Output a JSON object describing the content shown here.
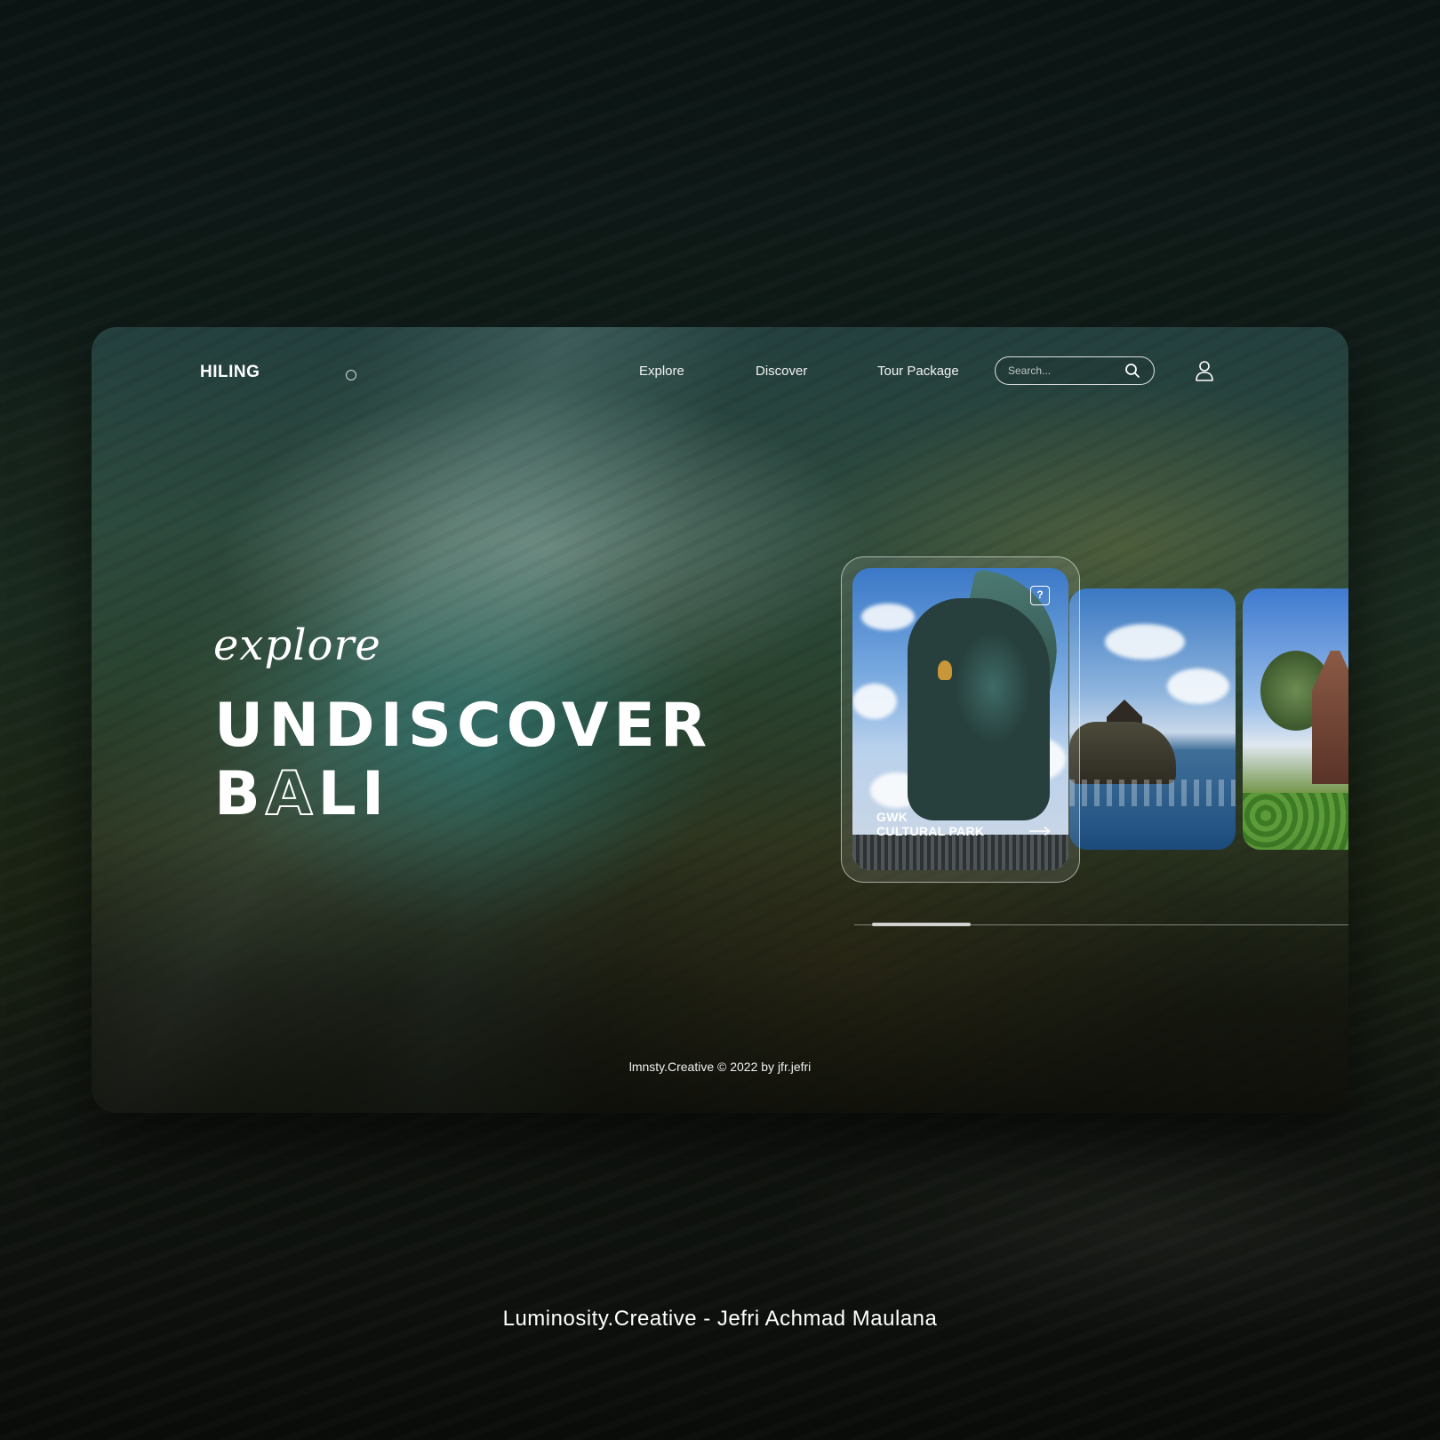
{
  "nav": {
    "logo": "HILING",
    "links": [
      "Explore",
      "Discover",
      "Tour Package"
    ],
    "search_placeholder": "Search..."
  },
  "hero": {
    "script": "explore",
    "line1": "UNDISCOVER",
    "line2_prefix": "B",
    "line2_outline": "A",
    "line2_suffix": "LI"
  },
  "carousel": {
    "active_card": {
      "title_line1": "GWK",
      "title_line2": "CULTURAL PARK",
      "help": "?"
    },
    "progress": 0.2
  },
  "footer": {
    "copyright": "lmnsty.Creative © 2022 by jfr.jefri"
  },
  "credit": "Luminosity.Creative - Jefri Achmad Maulana",
  "colors": {
    "text": "#ffffff",
    "frame_top": "#24403f",
    "teal_light": "#1e8c96",
    "page_bg": "#0b1313"
  },
  "icons": [
    "search-icon",
    "user-icon",
    "help-icon",
    "arrow-right-icon",
    "logo-mark-icon"
  ]
}
